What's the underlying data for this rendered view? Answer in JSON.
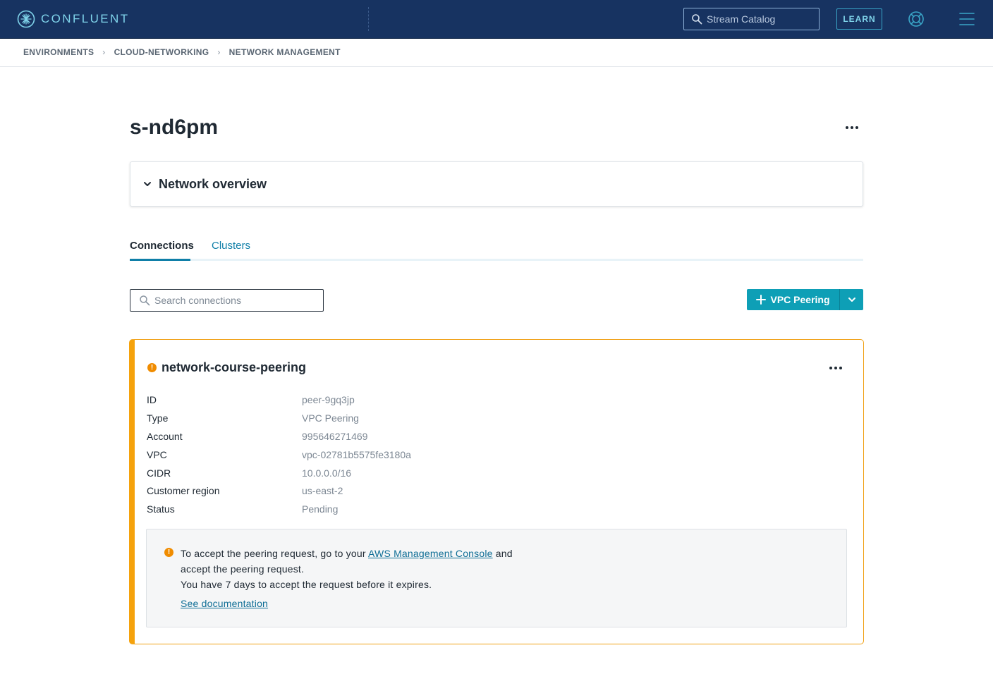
{
  "nav": {
    "brand": "CONFLUENT",
    "search_placeholder": "Stream Catalog",
    "learn_label": "LEARN"
  },
  "breadcrumb": [
    "ENVIRONMENTS",
    "CLOUD-NETWORKING",
    "NETWORK MANAGEMENT"
  ],
  "page": {
    "title": "s-nd6pm"
  },
  "overview": {
    "label": "Network overview"
  },
  "tabs": [
    {
      "label": "Connections",
      "active": true
    },
    {
      "label": "Clusters",
      "active": false
    }
  ],
  "search": {
    "placeholder": "Search connections"
  },
  "actions": {
    "vpc_peering_label": "VPC Peering"
  },
  "connection": {
    "name": "network-course-peering",
    "properties": [
      {
        "label": "ID",
        "value": "peer-9gq3jp"
      },
      {
        "label": "Type",
        "value": "VPC Peering"
      },
      {
        "label": "Account",
        "value": "995646271469"
      },
      {
        "label": "VPC",
        "value": "vpc-02781b5575fe3180a"
      },
      {
        "label": "CIDR",
        "value": "10.0.0.0/16"
      },
      {
        "label": "Customer region",
        "value": "us-east-2"
      },
      {
        "label": "Status",
        "value": "Pending"
      }
    ],
    "notice": {
      "line1_before": "To accept the peering request, go to your ",
      "line1_link": "AWS Management Console",
      "line1_after": " and",
      "line2": "accept the peering request.",
      "line3": "You have 7 days to accept the request before it expires.",
      "doc_link": "See documentation"
    }
  },
  "colors": {
    "nav_bg": "#173361",
    "accent": "#0e9fb6",
    "warning": "#f5a20c",
    "link": "#0f6e96"
  }
}
